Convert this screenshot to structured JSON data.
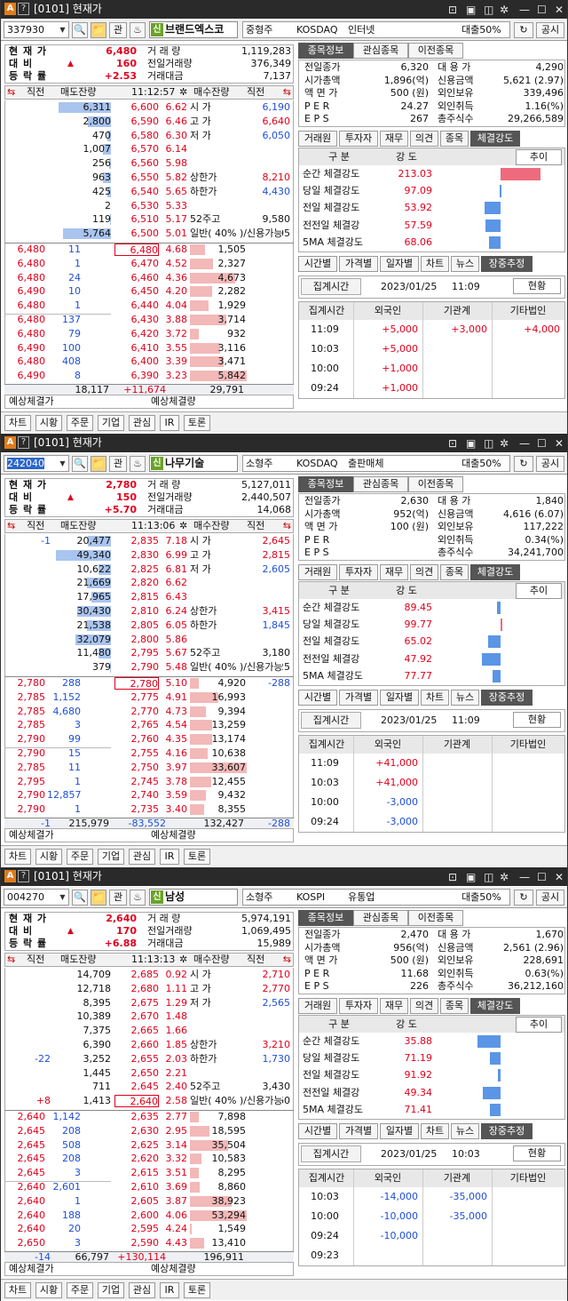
{
  "colors": {
    "up": "#e0001b",
    "down": "#1e4fd6",
    "sin_badge": "#6aa227",
    "tab_active": "#555555"
  },
  "common": {
    "title": "[0101] 현재가",
    "toolbar": {
      "gwan": "관",
      "gongsi": "공시"
    },
    "labels": {
      "cur_price": "현 재 가",
      "vs_prev": "대   비",
      "rate": "등 락 률",
      "volume": "거 래 량",
      "prev_volume": "전일거래량",
      "amount": "거래대금"
    },
    "ob_header": {
      "jikjeon": "직전",
      "sell": "매도잔량",
      "buy": "매수잔량",
      "jikjeon2": "직전"
    },
    "side_labels": [
      "시 가",
      "고 가",
      "저 가",
      "",
      "",
      "상한가",
      "하한가",
      "",
      "52주고",
      "52주저",
      "일반( 40% )/신용가능"
    ],
    "time_out": "시간외",
    "exp_labels": [
      "예상체결가",
      "예상체결량"
    ],
    "tabs1": [
      "종목정보",
      "관심종목",
      "이전종목"
    ],
    "info_labels": [
      "전일종가",
      "시가총액",
      "액 면 가",
      "P E R",
      "E P S"
    ],
    "info_labels2": [
      "대 용 가",
      "신용금액",
      "외인보유",
      "외인취득",
      "총주식수"
    ],
    "tabs2": [
      "거래원",
      "투자자",
      "재무",
      "의견",
      "종목",
      "체결강도"
    ],
    "str_head": [
      "구   분",
      "강   도",
      "추이"
    ],
    "str_labels": [
      "순간 체결강도",
      "당일 체결강도",
      "전일 체결강도",
      "전전일 체결강",
      "5MA 체결강도"
    ],
    "tabs3": [
      "시간별",
      "가격별",
      "일자별",
      "차트",
      "뉴스",
      "장중추정"
    ],
    "agg_label": "집계시간",
    "agg_date": "2023/01/25",
    "cur_btn": "현황",
    "inv_head": [
      "집계시간",
      "외국인",
      "기관계",
      "기타법인"
    ],
    "bottom": [
      "차트",
      "시황",
      "주문",
      "기업",
      "관심",
      "IR",
      "토론"
    ]
  },
  "panels": [
    {
      "code": "337930",
      "code_sel": false,
      "name": "브랜드엑스코",
      "size": "중형주",
      "market": "KOSDAQ",
      "sector": "인터넷",
      "loan": "대출50%",
      "price": "6,480",
      "change": "160",
      "rate": "+2.53",
      "volume": "1,119,283",
      "prev_volume": "376,349",
      "amount": "7,137",
      "amount_unit": "(백만)",
      "time": "11:12:57",
      "asks": [
        [
          "6,311",
          "6,600",
          "6.62"
        ],
        [
          "2,800",
          "6,590",
          "6.46"
        ],
        [
          "470",
          "6,580",
          "6.30"
        ],
        [
          "1,007",
          "6,570",
          "6.14"
        ],
        [
          "256",
          "6,560",
          "5.98"
        ],
        [
          "963",
          "6,550",
          "5.82"
        ],
        [
          "425",
          "6,540",
          "5.65"
        ],
        [
          "2",
          "6,530",
          "5.33"
        ],
        [
          "119",
          "6,510",
          "5.17"
        ],
        [
          "5,764",
          "6,500",
          "5.01"
        ]
      ],
      "ask_fill": [
        0.95,
        0.42,
        0.07,
        0.15,
        0.04,
        0.14,
        0.06,
        0.0,
        0.02,
        0.87
      ],
      "side_vals": [
        "6,190",
        "6,640",
        "6,050",
        "",
        "",
        "8,210",
        "4,430",
        "",
        "9,580",
        "4,405",
        ""
      ],
      "side_colors": [
        "blue",
        "red",
        "blue",
        "",
        "",
        "red",
        "blue",
        "",
        "",
        "",
        ""
      ],
      "trades": [
        [
          "6,480",
          "11"
        ],
        [
          "6,480",
          "1"
        ],
        [
          "6,480",
          "24"
        ],
        [
          "6,490",
          "10"
        ],
        [
          "6,480",
          "1"
        ],
        [
          "6,480",
          "137"
        ],
        [
          "6,480",
          "79"
        ],
        [
          "6,490",
          "100"
        ],
        [
          "6,480",
          "408"
        ],
        [
          "6,490",
          "8"
        ]
      ],
      "bids": [
        [
          "6,480",
          "4.68",
          "1,505"
        ],
        [
          "6,470",
          "4.52",
          "2,327"
        ],
        [
          "6,460",
          "4.36",
          "4,673"
        ],
        [
          "6,450",
          "4.20",
          "2,282"
        ],
        [
          "6,440",
          "4.04",
          "1,929"
        ],
        [
          "6,430",
          "3.88",
          "3,714"
        ],
        [
          "6,420",
          "3.72",
          "932"
        ],
        [
          "6,410",
          "3.55",
          "3,116"
        ],
        [
          "6,400",
          "3.39",
          "3,471"
        ],
        [
          "6,390",
          "3.23",
          "5,842"
        ]
      ],
      "bid_fill": [
        0.26,
        0.4,
        0.8,
        0.39,
        0.33,
        0.64,
        0.16,
        0.53,
        0.59,
        1.0
      ],
      "bid_highlight": 0,
      "totals": [
        "",
        "18,117",
        "+11,674",
        "29,791",
        ""
      ],
      "info": [
        "6,320",
        "1,896(억)",
        "500 (원)",
        "24.27",
        "267"
      ],
      "info2": [
        "4,290",
        "5,621   (2.97)",
        "339,496",
        "1.16(%)",
        "29,266,589"
      ],
      "strength": [
        "213.03",
        "97.09",
        "53.92",
        "57.59",
        "68.06"
      ],
      "str_val": [
        1.13,
        -0.03,
        -0.46,
        -0.42,
        -0.32
      ],
      "agg_time": "11:09",
      "inv_rows": [
        [
          "11:09",
          "+5,000",
          "+3,000",
          "+4,000"
        ],
        [
          "10:03",
          "+5,000",
          "",
          ""
        ],
        [
          "10:00",
          "+1,000",
          "",
          ""
        ],
        [
          "09:24",
          "+1,000",
          "",
          ""
        ]
      ]
    },
    {
      "code": "242040",
      "code_sel": true,
      "name": "나무기술",
      "size": "소형주",
      "market": "KOSDAQ",
      "sector": "출판매체",
      "loan": "대출50%",
      "price": "2,780",
      "change": "150",
      "rate": "+5.70",
      "volume": "5,127,011",
      "prev_volume": "2,440,507",
      "amount": "14,068",
      "amount_unit": "(백만)",
      "time": "11:13:06",
      "asks": [
        [
          "20,477",
          "2,835",
          "7.18"
        ],
        [
          "49,340",
          "2,830",
          "6.99"
        ],
        [
          "10,622",
          "2,825",
          "6.81"
        ],
        [
          "21,669",
          "2,820",
          "6.62"
        ],
        [
          "17,965",
          "2,815",
          "6.43"
        ],
        [
          "30,430",
          "2,810",
          "6.24"
        ],
        [
          "21,538",
          "2,805",
          "6.05"
        ],
        [
          "32,079",
          "2,800",
          "5.86"
        ],
        [
          "11,480",
          "2,795",
          "5.67"
        ],
        [
          "379",
          "2,790",
          "5.48"
        ]
      ],
      "ask_fill": [
        0.42,
        1.0,
        0.22,
        0.44,
        0.36,
        0.62,
        0.44,
        0.65,
        0.23,
        0.01
      ],
      "ask_jik": [
        "-1",
        "",
        "",
        "",
        "",
        "",
        "",
        "",
        "",
        ""
      ],
      "side_vals": [
        "2,645",
        "2,815",
        "2,605",
        "",
        "",
        "3,415",
        "1,845",
        "",
        "3,180",
        "1,525",
        ""
      ],
      "side_colors": [
        "red",
        "red",
        "blue",
        "",
        "",
        "red",
        "blue",
        "",
        "",
        "",
        ""
      ],
      "trades": [
        [
          "2,780",
          "288"
        ],
        [
          "2,785",
          "1,152"
        ],
        [
          "2,785",
          "4,680"
        ],
        [
          "2,785",
          "3"
        ],
        [
          "2,790",
          "99"
        ],
        [
          "2,790",
          "15"
        ],
        [
          "2,785",
          "11"
        ],
        [
          "2,795",
          "1"
        ],
        [
          "2,790",
          "12,857"
        ],
        [
          "2,790",
          "1"
        ]
      ],
      "bids": [
        [
          "2,780",
          "5.10",
          "4,920"
        ],
        [
          "2,775",
          "4.91",
          "16,993"
        ],
        [
          "2,770",
          "4.73",
          "9,394"
        ],
        [
          "2,765",
          "4.54",
          "13,259"
        ],
        [
          "2,760",
          "4.35",
          "13,174"
        ],
        [
          "2,755",
          "4.16",
          "10,638"
        ],
        [
          "2,750",
          "3.97",
          "33,607"
        ],
        [
          "2,745",
          "3.78",
          "12,455"
        ],
        [
          "2,740",
          "3.59",
          "9,432"
        ],
        [
          "2,735",
          "3.40",
          "8,355"
        ]
      ],
      "bid_fill": [
        0.15,
        0.5,
        0.28,
        0.39,
        0.39,
        0.32,
        1.0,
        0.37,
        0.28,
        0.25
      ],
      "bid_highlight": 0,
      "bid_jik": [
        "-288",
        "",
        "",
        "",
        "",
        "",
        "",
        "",
        "",
        ""
      ],
      "totals": [
        "-1",
        "215,979",
        "-83,552",
        "132,427",
        "-288"
      ],
      "info": [
        "2,630",
        "952(억)",
        "100 (원)",
        "",
        ""
      ],
      "info2": [
        "1,840",
        "4,616   (6.07)",
        "117,222",
        "0.34(%)",
        "34,241,700"
      ],
      "strength": [
        "89.45",
        "99.77",
        "65.02",
        "47.92",
        "77.77"
      ],
      "str_val": [
        -0.1,
        0.0,
        -0.34,
        -0.52,
        -0.22
      ],
      "agg_time": "11:09",
      "inv_rows": [
        [
          "11:09",
          "+41,000",
          "",
          ""
        ],
        [
          "10:03",
          "+41,000",
          "",
          ""
        ],
        [
          "10:00",
          "-3,000",
          "",
          ""
        ],
        [
          "09:24",
          "-3,000",
          "",
          ""
        ]
      ]
    },
    {
      "code": "004270",
      "code_sel": false,
      "name": "남성",
      "size": "소형주",
      "market": "KOSPI",
      "sector": "유통업",
      "loan": "대출50%",
      "price": "2,640",
      "change": "170",
      "rate": "+6.88",
      "volume": "5,974,191",
      "prev_volume": "1,069,495",
      "amount": "15,989",
      "amount_unit": "(백만)",
      "time": "11:13:13",
      "asks": [
        [
          "14,709",
          "2,685",
          "0.92"
        ],
        [
          "12,718",
          "2,680",
          "1.11"
        ],
        [
          "8,395",
          "2,675",
          "1.29"
        ],
        [
          "10,389",
          "2,670",
          "1.48"
        ],
        [
          "7,375",
          "2,665",
          "1.66"
        ],
        [
          "6,390",
          "2,660",
          "1.85"
        ],
        [
          "3,252",
          "2,655",
          "2.03"
        ],
        [
          "1,445",
          "2,650",
          "2.21"
        ],
        [
          "711",
          "2,645",
          "2.40"
        ],
        [
          "1,413",
          "2,640",
          "2.58"
        ]
      ],
      "ask_fill": [
        0,
        0,
        0,
        0,
        0,
        0,
        0,
        0,
        0,
        0
      ],
      "ask_jik": [
        "",
        "",
        "",
        "",
        "",
        "",
        "-22",
        "",
        "",
        "+8"
      ],
      "side_vals": [
        "2,710",
        "2,770",
        "2,565",
        "",
        "",
        "3,210",
        "1,730",
        "",
        "3,430",
        "1,660",
        ""
      ],
      "side_colors": [
        "red",
        "red",
        "blue",
        "",
        "",
        "red",
        "blue",
        "",
        "",
        "",
        ""
      ],
      "trades": [
        [
          "2,640",
          "1,142"
        ],
        [
          "2,645",
          "208"
        ],
        [
          "2,645",
          "508"
        ],
        [
          "2,645",
          "208"
        ],
        [
          "2,645",
          "3"
        ],
        [
          "2,640",
          "2,601"
        ],
        [
          "2,640",
          "1"
        ],
        [
          "2,640",
          "188"
        ],
        [
          "2,640",
          "20"
        ],
        [
          "2,650",
          "3"
        ]
      ],
      "bids": [
        [
          "2,635",
          "2.77",
          "7,898"
        ],
        [
          "2,630",
          "2.95",
          "18,595"
        ],
        [
          "2,625",
          "3.14",
          "35,504"
        ],
        [
          "2,620",
          "3.32",
          "10,583"
        ],
        [
          "2,615",
          "3.51",
          "8,295"
        ],
        [
          "2,610",
          "3.69",
          "8,860"
        ],
        [
          "2,605",
          "3.87",
          "38,923"
        ],
        [
          "2,600",
          "4.06",
          "53,294"
        ],
        [
          "2,595",
          "4.24",
          "1,549"
        ],
        [
          "2,590",
          "4.43",
          "13,410"
        ]
      ],
      "bid_fill": [
        0.15,
        0.35,
        0.67,
        0.2,
        0.16,
        0.17,
        0.73,
        1.0,
        0.03,
        0.25
      ],
      "bid_highlight": -1,
      "ask_highlight": 9,
      "totals": [
        "-14",
        "66,797",
        "+130,114",
        "196,911",
        ""
      ],
      "info": [
        "2,470",
        "956(억)",
        "500 (원)",
        "11.68",
        "226"
      ],
      "info2": [
        "1,670",
        "2,561   (2.96)",
        "228,691",
        "0.63(%)",
        "36,212,160"
      ],
      "strength": [
        "35.88",
        "71.19",
        "91.92",
        "49.34",
        "71.41"
      ],
      "str_val": [
        -0.64,
        -0.29,
        -0.08,
        -0.51,
        -0.29
      ],
      "agg_time": "10:03",
      "inv_rows": [
        [
          "10:03",
          "-14,000",
          "-35,000",
          ""
        ],
        [
          "10:00",
          "-10,000",
          "-35,000",
          ""
        ],
        [
          "09:24",
          "-10,000",
          "",
          ""
        ],
        [
          "09:23",
          "",
          "",
          ""
        ]
      ]
    }
  ]
}
